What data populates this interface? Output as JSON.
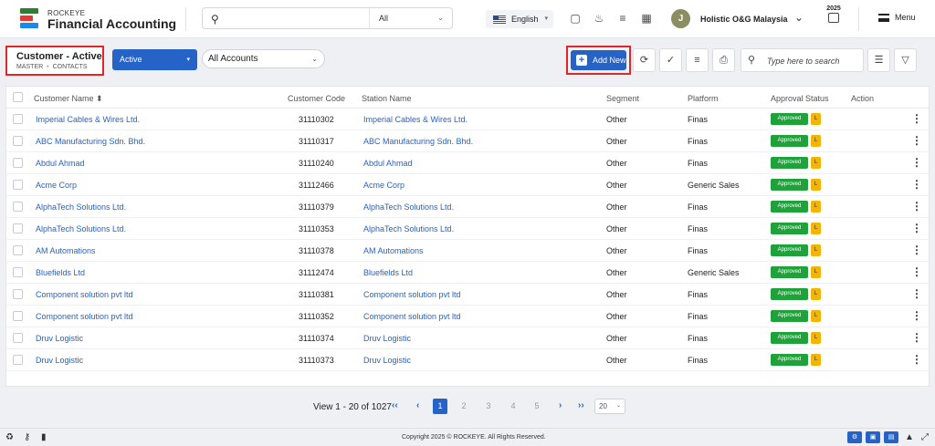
{
  "header": {
    "brand_top": "ROCKEYE",
    "brand_main": "Financial Accounting",
    "search_scope": "All",
    "language": "English",
    "avatar_initial": "J",
    "company": "Holistic O&G Malaysia",
    "year": "2025",
    "menu_label": "Menu"
  },
  "toolbar": {
    "page_title": "Customer - Active",
    "breadcrumb": [
      "MASTER",
      "CONTACTS"
    ],
    "status_filter": "Active",
    "account_filter": "All Accounts",
    "add_new_label": "Add New",
    "search_placeholder": "Type here to search"
  },
  "table": {
    "columns": [
      "Customer Name",
      "Customer Code",
      "Station Name",
      "Segment",
      "Platform",
      "Approval Status",
      "Action"
    ],
    "sort_indicator": "⬍",
    "rows": [
      {
        "name": "Imperial Cables & Wires Ltd.",
        "code": "31110302",
        "station": "Imperial Cables & Wires Ltd.",
        "segment": "Other",
        "platform": "Finas",
        "status": "Approved",
        "level": "L"
      },
      {
        "name": "ABC Manufacturing Sdn. Bhd.",
        "code": "31110317",
        "station": "ABC Manufacturing Sdn. Bhd.",
        "segment": "Other",
        "platform": "Finas",
        "status": "Approved",
        "level": "L"
      },
      {
        "name": "Abdul Ahmad",
        "code": "31110240",
        "station": "Abdul Ahmad",
        "segment": "Other",
        "platform": "Finas",
        "status": "Approved",
        "level": "L"
      },
      {
        "name": "Acme Corp",
        "code": "31112466",
        "station": "Acme Corp",
        "segment": "Other",
        "platform": "Generic Sales",
        "status": "Approved",
        "level": "L"
      },
      {
        "name": "AlphaTech Solutions Ltd.",
        "code": "31110379",
        "station": "AlphaTech Solutions Ltd.",
        "segment": "Other",
        "platform": "Finas",
        "status": "Approved",
        "level": "L"
      },
      {
        "name": "AlphaTech Solutions Ltd.",
        "code": "31110353",
        "station": "AlphaTech Solutions Ltd.",
        "segment": "Other",
        "platform": "Finas",
        "status": "Approved",
        "level": "L"
      },
      {
        "name": "AM Automations",
        "code": "31110378",
        "station": "AM Automations",
        "segment": "Other",
        "platform": "Finas",
        "status": "Approved",
        "level": "L"
      },
      {
        "name": "Bluefields Ltd",
        "code": "31112474",
        "station": "Bluefields Ltd",
        "segment": "Other",
        "platform": "Generic Sales",
        "status": "Approved",
        "level": "L"
      },
      {
        "name": "Component solution pvt ltd",
        "code": "31110381",
        "station": "Component solution pvt ltd",
        "segment": "Other",
        "platform": "Finas",
        "status": "Approved",
        "level": "L"
      },
      {
        "name": "Component solution pvt ltd",
        "code": "31110352",
        "station": "Component solution pvt ltd",
        "segment": "Other",
        "platform": "Finas",
        "status": "Approved",
        "level": "L"
      },
      {
        "name": "Druv Logistic",
        "code": "31110374",
        "station": "Druv Logistic",
        "segment": "Other",
        "platform": "Finas",
        "status": "Approved",
        "level": "L"
      },
      {
        "name": "Druv Logistic",
        "code": "31110373",
        "station": "Druv Logistic",
        "segment": "Other",
        "platform": "Finas",
        "status": "Approved",
        "level": "L"
      }
    ]
  },
  "pagination": {
    "summary": "View 1 - 20 of 1027",
    "pages": [
      "1",
      "2",
      "3",
      "4",
      "5"
    ],
    "current_page": "1",
    "page_size": "20"
  },
  "footer": {
    "copyright": "Copyright 2025 © ROCKEYE. All Rights Reserved."
  },
  "colors": {
    "primary": "#2563c7",
    "approved": "#1fa23a",
    "level": "#f5b400",
    "highlight": "#e0252b"
  }
}
